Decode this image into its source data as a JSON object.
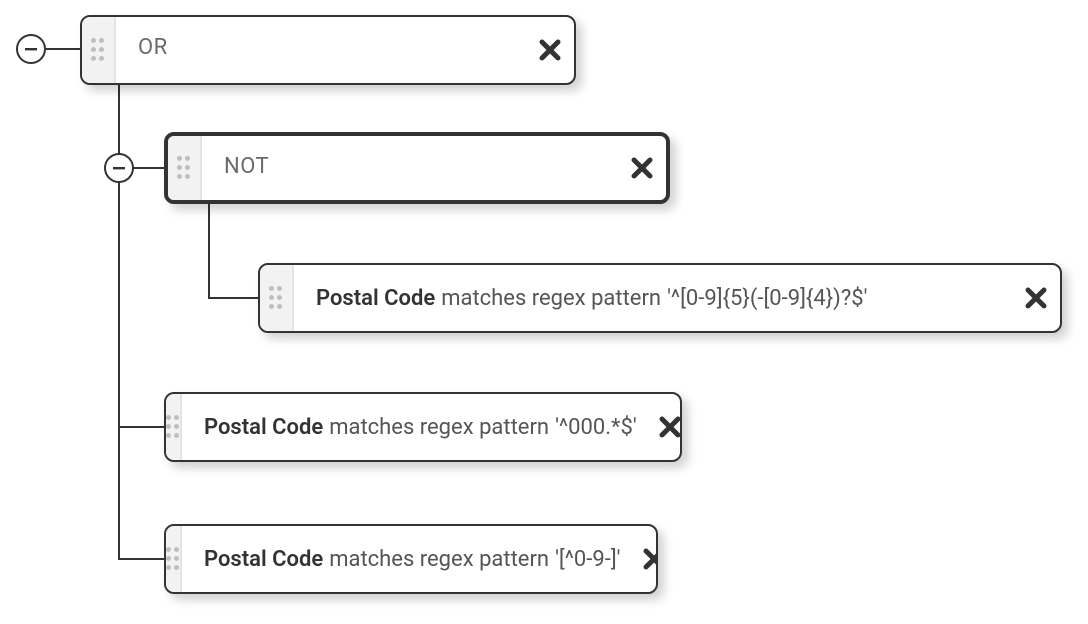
{
  "operators": {
    "root": "OR",
    "not": "NOT"
  },
  "conditions": {
    "c1": {
      "field": "Postal Code",
      "relation": "matches regex pattern",
      "value": "'^[0-9]{5}(-[0-9]{4})?$'"
    },
    "c2": {
      "field": "Postal Code",
      "relation": "matches regex pattern",
      "value": "'^000.*$'"
    },
    "c3": {
      "field": "Postal Code",
      "relation": "matches regex pattern",
      "value": "'[^0-9-]'"
    }
  }
}
